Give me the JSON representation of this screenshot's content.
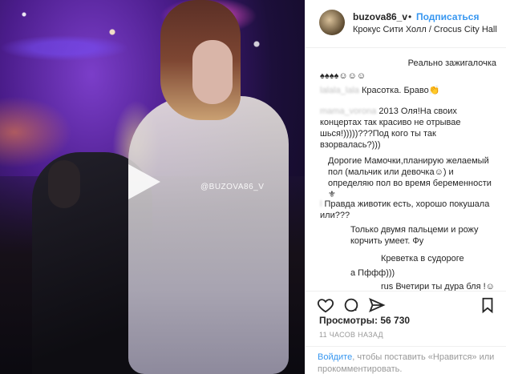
{
  "post": {
    "username": "buzova86_v",
    "separator": "•",
    "follow_label": "Подписаться",
    "location": "Крокус Сити Холл / Crocus City Hall",
    "watermark": "@BUZOVA86_V"
  },
  "comments": [
    {
      "text": "Реально зажигалочка",
      "align": "right"
    },
    {
      "text": "♠♠♠♠☺☺☺",
      "align": "left"
    },
    {
      "text": "Красотка. Браво👏",
      "align": "left",
      "blurred_prefix": "lalala_lala"
    },
    {
      "text": "2013 Оля!На своих концертах так красиво не отрывае шься!)))))???Под кого ты так взорвалась?)))",
      "align": "left",
      "blurred_prefix": "mama_vorona"
    },
    {
      "text": "Дорогие Мамочки,планирую желаемый пол (мальчик или девочка☺) и определяю пол во время беременности ⚜",
      "align": "left"
    },
    {
      "text": "Правда животик есть, хорошо покушала или???",
      "align": "left",
      "blurred_prefix": "l"
    },
    {
      "text": "Только двумя пальцеми и рожу корчить умеет. Фу",
      "align": "left"
    },
    {
      "text": "Креветка в судороге",
      "align": "left"
    },
    {
      "text": "а Пффф)))",
      "align": "left"
    },
    {
      "text": "rus Вчетири ты дура бля !☺",
      "align": "left"
    }
  ],
  "actions": {
    "like_icon": "heart-icon",
    "comment_icon": "comment-icon",
    "share_icon": "share-icon",
    "save_icon": "bookmark-icon"
  },
  "stats": {
    "views": "Просмотры: 56 730",
    "time_ago": "11 ЧАСОВ НАЗАД"
  },
  "login": {
    "login_link": "Войдите",
    "text": ", чтобы поставить «Нравится» или прокомментировать."
  },
  "colors": {
    "link": "#3897f0",
    "text": "#262626",
    "muted": "#999999"
  }
}
